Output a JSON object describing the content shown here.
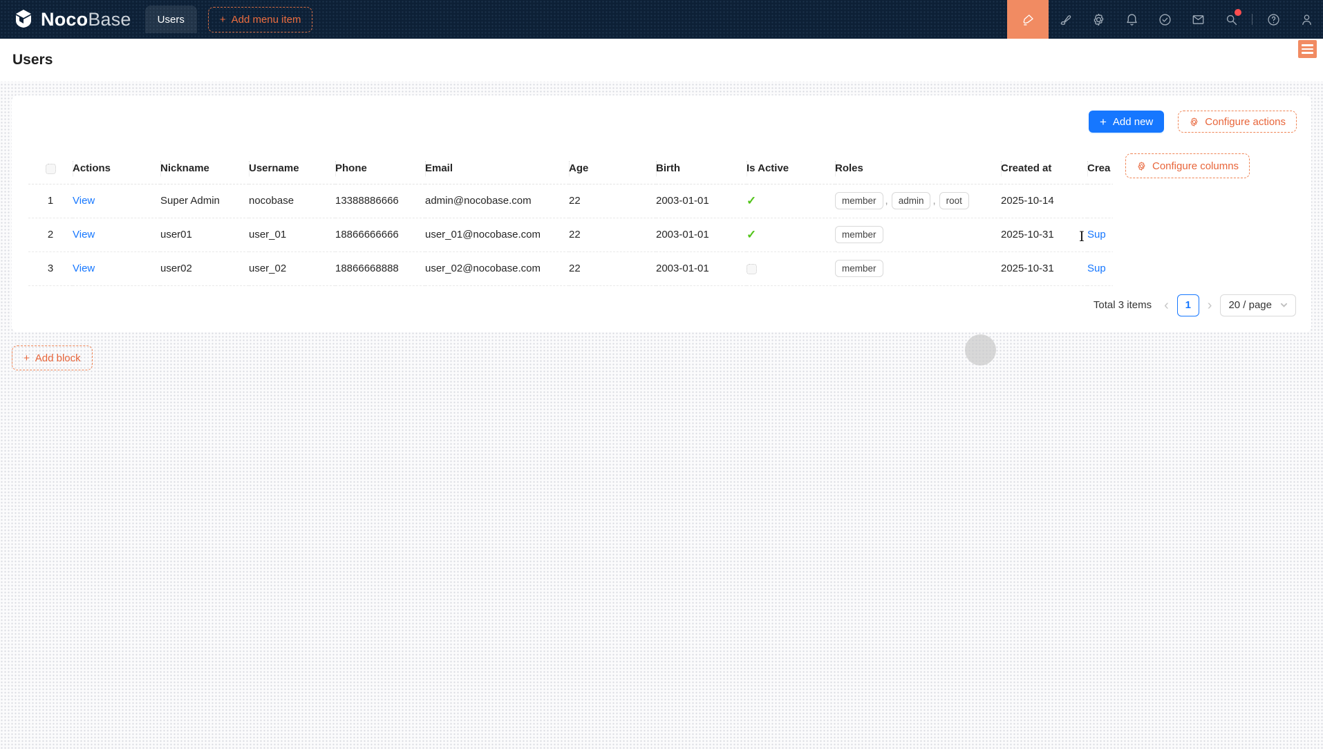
{
  "colors": {
    "accent_blue": "#1677ff",
    "designer_orange": "#e8653a",
    "designer_orange_bg": "#f18b62",
    "success_green": "#52c41a",
    "badge_red": "#ff4d4f",
    "navbar_bg": "#0d2036"
  },
  "icons": {
    "plus": "+",
    "check": "✓",
    "prev_arrow": "‹",
    "next_arrow": "›",
    "roles_separator": ",",
    "help_glyph": "?",
    "ibeam_glyph": "I"
  },
  "navbar": {
    "logo_primary": "Noco",
    "logo_secondary": "Base",
    "tabs": [
      {
        "label": "Users",
        "active": true
      }
    ],
    "add_menu_item_label": "Add menu item",
    "right_icons": [
      "ui-editor-icon",
      "theme-editor-icon",
      "settings-icon",
      "notifications-icon",
      "tasks-icon",
      "messages-icon",
      "search-icon",
      "help-icon",
      "user-icon"
    ],
    "search_has_badge": true
  },
  "page": {
    "title": "Users"
  },
  "toolbar": {
    "add_new_label": "Add new",
    "configure_actions_label": "Configure actions",
    "configure_columns_label": "Configure columns"
  },
  "table": {
    "columns": [
      "Actions",
      "Nickname",
      "Username",
      "Phone",
      "Email",
      "Age",
      "Birth",
      "Is Active",
      "Roles",
      "Created at",
      "Crea"
    ],
    "rows": [
      {
        "index": "1",
        "action": "View",
        "nickname": "Super Admin",
        "username": "nocobase",
        "phone": "13388886666",
        "email": "admin@nocobase.com",
        "age": "22",
        "birth": "2003-01-01",
        "is_active": true,
        "roles": [
          "member",
          "admin",
          "root"
        ],
        "created_at": "2025-10-14",
        "created_by": ""
      },
      {
        "index": "2",
        "action": "View",
        "nickname": "user01",
        "username": "user_01",
        "phone": "18866666666",
        "email": "user_01@nocobase.com",
        "age": "22",
        "birth": "2003-01-01",
        "is_active": true,
        "roles": [
          "member"
        ],
        "created_at": "2025-10-31",
        "created_by": "Sup"
      },
      {
        "index": "3",
        "action": "View",
        "nickname": "user02",
        "username": "user_02",
        "phone": "18866668888",
        "email": "user_02@nocobase.com",
        "age": "22",
        "birth": "2003-01-01",
        "is_active": false,
        "roles": [
          "member"
        ],
        "created_at": "2025-10-31",
        "created_by": "Sup"
      }
    ]
  },
  "pagination": {
    "total_label": "Total 3 items",
    "current_page": "1",
    "page_size_label": "20 / page"
  },
  "add_block_label": "Add block"
}
